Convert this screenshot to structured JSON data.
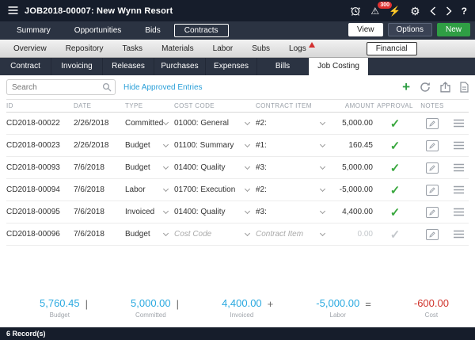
{
  "icons": {
    "warning": "⚠",
    "lightning": "⚡",
    "gear": "⚙",
    "help": "?",
    "check": "✓",
    "plus": "+"
  },
  "titlebar": {
    "title": "JOB2018-00007: New Wynn Resort",
    "alert_count": "300"
  },
  "main_tabs": {
    "items": [
      {
        "label": "Summary"
      },
      {
        "label": "Opportunities"
      },
      {
        "label": "Bids"
      },
      {
        "label": "Contracts",
        "active": true
      }
    ],
    "view_button": "View",
    "options_button": "Options",
    "new_button": "New"
  },
  "module_tabs": {
    "items": [
      {
        "label": "Overview"
      },
      {
        "label": "Repository"
      },
      {
        "label": "Tasks"
      },
      {
        "label": "Materials"
      },
      {
        "label": "Labor"
      },
      {
        "label": "Subs"
      },
      {
        "label": "Logs",
        "warning": true
      },
      {
        "label": "Financial",
        "active": true
      }
    ]
  },
  "financial_tabs": {
    "items": [
      {
        "label": "Contract"
      },
      {
        "label": "Invoicing"
      },
      {
        "label": "Releases"
      },
      {
        "label": "Purchases"
      },
      {
        "label": "Expenses"
      },
      {
        "label": "Bills"
      },
      {
        "label": "Job Costing",
        "active": true
      }
    ]
  },
  "toolbar": {
    "search_placeholder": "Search",
    "hide_approved_link": "Hide Approved Entries"
  },
  "table": {
    "columns": [
      "ID",
      "DATE",
      "TYPE",
      "COST CODE",
      "CONTRACT ITEM",
      "AMOUNT",
      "APPROVAL",
      "NOTES"
    ],
    "rows": [
      {
        "id": "CD2018-00022",
        "date": "2/26/2018",
        "type": "Committed",
        "cost_code": "01000: General",
        "contract_item": "#2:",
        "amount": "5,000.00",
        "approved": true
      },
      {
        "id": "CD2018-00023",
        "date": "2/26/2018",
        "type": "Budget",
        "cost_code": "01100: Summary",
        "contract_item": "#1:",
        "amount": "160.45",
        "approved": true
      },
      {
        "id": "CD2018-00093",
        "date": "7/6/2018",
        "type": "Budget",
        "cost_code": "01400: Quality",
        "contract_item": "#3:",
        "amount": "5,000.00",
        "approved": true
      },
      {
        "id": "CD2018-00094",
        "date": "7/6/2018",
        "type": "Labor",
        "cost_code": "01700: Execution",
        "contract_item": "#2:",
        "amount": "-5,000.00",
        "approved": true
      },
      {
        "id": "CD2018-00095",
        "date": "7/6/2018",
        "type": "Invoiced",
        "cost_code": "01400: Quality",
        "contract_item": "#3:",
        "amount": "4,400.00",
        "approved": true
      },
      {
        "id": "CD2018-00096",
        "date": "7/6/2018",
        "type": "Budget",
        "cost_code": "Cost Code",
        "contract_item": "Contract Item",
        "amount": "0.00",
        "approved": false,
        "placeholder": true
      }
    ]
  },
  "summary": {
    "items": [
      {
        "value": "5,760.45",
        "label": "Budget",
        "op": "|"
      },
      {
        "value": "5,000.00",
        "label": "Committed",
        "op": "|"
      },
      {
        "value": "4,400.00",
        "label": "Invoiced",
        "op": "+"
      },
      {
        "value": "-5,000.00",
        "label": "Labor",
        "op": "="
      },
      {
        "value": "-600.00",
        "label": "Cost",
        "op": "",
        "negative": true
      }
    ]
  },
  "statusbar": {
    "record_count": "6 Record(s)"
  }
}
